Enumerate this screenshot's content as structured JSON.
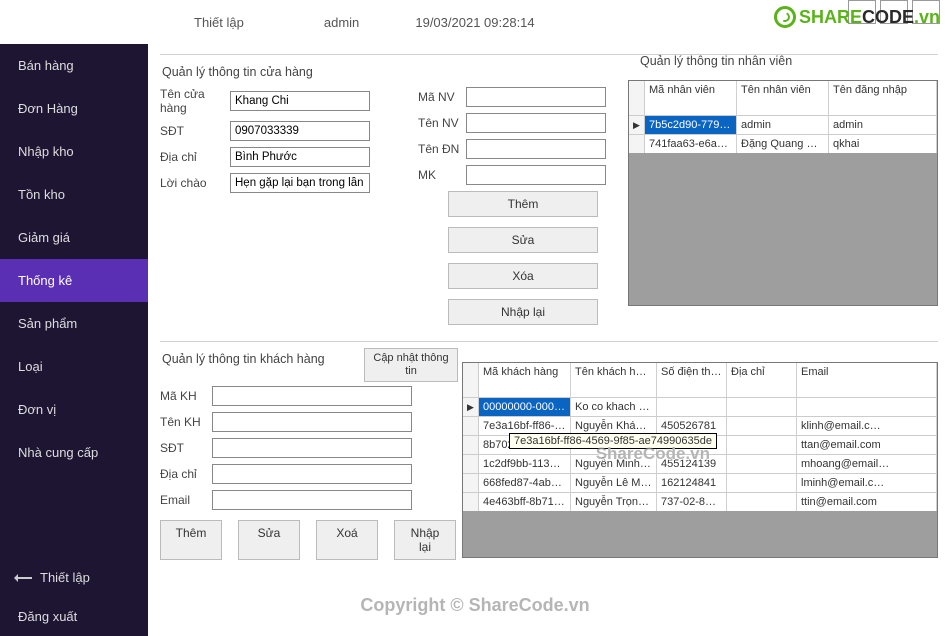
{
  "header": {
    "breadcrumb1": "Thiết lập",
    "breadcrumb2": "admin",
    "timestamp": "19/03/2021 09:28:14"
  },
  "logo": {
    "brand_a": "SHARE",
    "brand_b": "CODE",
    "brand_c": ".vn"
  },
  "sidebar": {
    "items": [
      "Bán hàng",
      "Đơn Hàng",
      "Nhập kho",
      "Tồn kho",
      "Giảm giá",
      "Thống kê",
      "Sản phẩm",
      "Loại",
      "Đơn vị",
      "Nhà cung cấp"
    ],
    "active_index": 5,
    "footer": {
      "settings": "Thiết lập",
      "logout": "Đăng xuất"
    }
  },
  "store": {
    "title": "Quản lý thông tin cửa hàng",
    "fields": {
      "name_lbl": "Tên cửa hàng",
      "name_val": "Khang Chi",
      "phone_lbl": "SĐT",
      "phone_val": "0907033339",
      "addr_lbl": "Địa chỉ",
      "addr_val": "Bình Phước",
      "greet_lbl": "Lời chào",
      "greet_val": "Hẹn gặp lại bạn trong lần tới!"
    }
  },
  "employee": {
    "title": "Quản lý thông tin nhân viên",
    "fields": {
      "id_lbl": "Mã NV",
      "id_val": "",
      "name_lbl": "Tên NV",
      "name_val": "",
      "login_lbl": "Tên ĐN",
      "login_val": "",
      "pw_lbl": "MK",
      "pw_val": ""
    },
    "buttons": {
      "add": "Thêm",
      "edit": "Sửa",
      "del": "Xóa",
      "reset": "Nhập lại"
    },
    "grid": {
      "headers": [
        "Mã nhân viên",
        "Tên nhân viên",
        "Tên đăng nhập"
      ],
      "rows": [
        {
          "selected": true,
          "id": "7b5c2d90-7798…",
          "name": "admin",
          "login": "admin"
        },
        {
          "selected": false,
          "id": "741faa63-e6ac-…",
          "name": "Đặng Quang K…",
          "login": "qkhai"
        }
      ]
    }
  },
  "customer": {
    "title": "Quản lý thông tin khách hàng",
    "update_btn": "Cập nhật thông tin",
    "fields": {
      "id_lbl": "Mã KH",
      "id_val": "",
      "name_lbl": "Tên KH",
      "name_val": "",
      "phone_lbl": "SĐT",
      "phone_val": "",
      "addr_lbl": "Địa chỉ",
      "addr_val": "",
      "email_lbl": "Email",
      "email_val": ""
    },
    "buttons": {
      "add": "Thêm",
      "edit": "Sửa",
      "del": "Xoá",
      "reset": "Nhập lại"
    },
    "grid": {
      "headers": [
        "Mã khách hàng",
        "Tên khách hàng",
        "Số điện thoại",
        "Địa chỉ",
        "Email"
      ],
      "rows": [
        {
          "selected": true,
          "id": "00000000-0000-…",
          "name": "Ko co khach ha…",
          "phone": "",
          "addr": "",
          "email": ""
        },
        {
          "id": "7e3a16bf-ff86-4…",
          "name": "Nguyễn Khánh …",
          "phone": "450526781",
          "addr": "",
          "email": "klinh@email.c…"
        },
        {
          "id": "8b702",
          "name": "",
          "phone": "",
          "addr": "",
          "email": "ttan@email.com"
        },
        {
          "id": "1c2df9bb-1133-…",
          "name": "Nguyễn Minh …",
          "phone": "455124139",
          "addr": "",
          "email": "mhoang@email…"
        },
        {
          "id": "668fed87-4abd-…",
          "name": "Nguyễn Lê Minh",
          "phone": "162124841",
          "addr": "",
          "email": "lminh@email.c…"
        },
        {
          "id": "4e463bff-8b71-…",
          "name": "Nguyễn Trọng …",
          "phone": "737-02-8831",
          "addr": "",
          "email": "ttin@email.com"
        }
      ],
      "tooltip": "7e3a16bf-ff86-4569-9f85-ae74990635de"
    }
  },
  "watermarks": {
    "wm1": "ShareCode.vn",
    "wm2": "Copyright © ShareCode.vn"
  }
}
